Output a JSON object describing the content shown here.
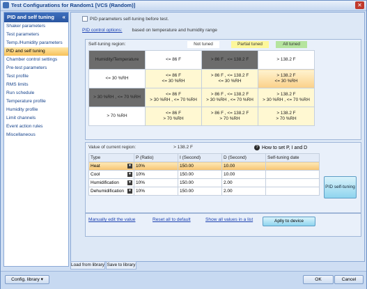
{
  "window": {
    "title": "Test Configurations for Random1 [VCS (Random)]"
  },
  "sidebar": {
    "header": "PID and self tuning",
    "items": [
      {
        "label": "Shaker parameters"
      },
      {
        "label": "Test parameters"
      },
      {
        "label": "Temp./Humidity parameters"
      },
      {
        "label": "PID and self tuning"
      },
      {
        "label": "Chamber control settings"
      },
      {
        "label": "Pre-test parameters"
      },
      {
        "label": "Test profile"
      },
      {
        "label": "RMS limits"
      },
      {
        "label": "Run schedule"
      },
      {
        "label": "Temperature profile"
      },
      {
        "label": "Humidity profile"
      },
      {
        "label": "Limit channels"
      },
      {
        "label": "Event action rules"
      },
      {
        "label": "Miscellaneous"
      }
    ]
  },
  "main": {
    "self_tuning_checkbox": "PID parameters self-tuning before test.",
    "pid_control_options_link": "PID control options:",
    "pid_control_options_desc": "based on temperature and humidity range",
    "region": {
      "label": "Self-tuning region:",
      "legend": {
        "not_tuned": "Not tuned",
        "partial_tuned": "Partial tuned",
        "all_tuned": "All tuned"
      },
      "header": [
        "Humidity/Temperature",
        "<= 86 F",
        "> 86 F , <= 138.2 F",
        "> 138.2 F"
      ],
      "rows": [
        {
          "h": "<= 30 %RH",
          "c1": "<= 86 F\n<= 30 %RH",
          "c2": "> 86 F , <= 138.2 F\n<= 30 %RH",
          "c3": "> 138.2 F\n<= 30 %RH"
        },
        {
          "h": "> 30 %RH , <= 70 %RH",
          "c1": "<= 86 F\n> 30 %RH , <= 70 %RH",
          "c2": "> 86 F , <= 138.2 F\n> 30 %RH , <= 70 %RH",
          "c3": "> 138.2 F\n> 30 %RH , <= 70 %RH"
        },
        {
          "h": "> 70 %RH",
          "c1": "<= 86 F\n> 70 %RH",
          "c2": "> 86 F , <= 138.2 F\n> 70 %RH",
          "c3": "> 138.2 F\n> 70 %RH"
        }
      ]
    },
    "current": {
      "label": "Value of current region:",
      "value": "> 138.2 F",
      "howto": "How to set P, I and D"
    },
    "table": {
      "headers": [
        "Type",
        "P (Ratio)",
        "I (Second)",
        "D (Second)",
        "Self-tuning date"
      ],
      "rows": [
        {
          "type": "Heat",
          "p": "10%",
          "i": "150.00",
          "d": "10.00",
          "date": ""
        },
        {
          "type": "Cool",
          "p": "10%",
          "i": "150.00",
          "d": "10.00",
          "date": ""
        },
        {
          "type": "Humidification",
          "p": "10%",
          "i": "150.00",
          "d": "2.00",
          "date": ""
        },
        {
          "type": "Dehumidification",
          "p": "10%",
          "i": "150.00",
          "d": "2.00",
          "date": ""
        }
      ]
    },
    "pid_self_tuning_button": "PID self-tuning",
    "actions": {
      "manual_edit": "Manually edit the value",
      "reset_default": "Reset all to default",
      "show_all": "Show all values in a list",
      "apply": "Aplly to device"
    }
  },
  "footer": {
    "load_library": "Load from library",
    "save_library": "Save to library",
    "config_library": "Config. library",
    "ok": "OK",
    "cancel": "Cancel"
  }
}
